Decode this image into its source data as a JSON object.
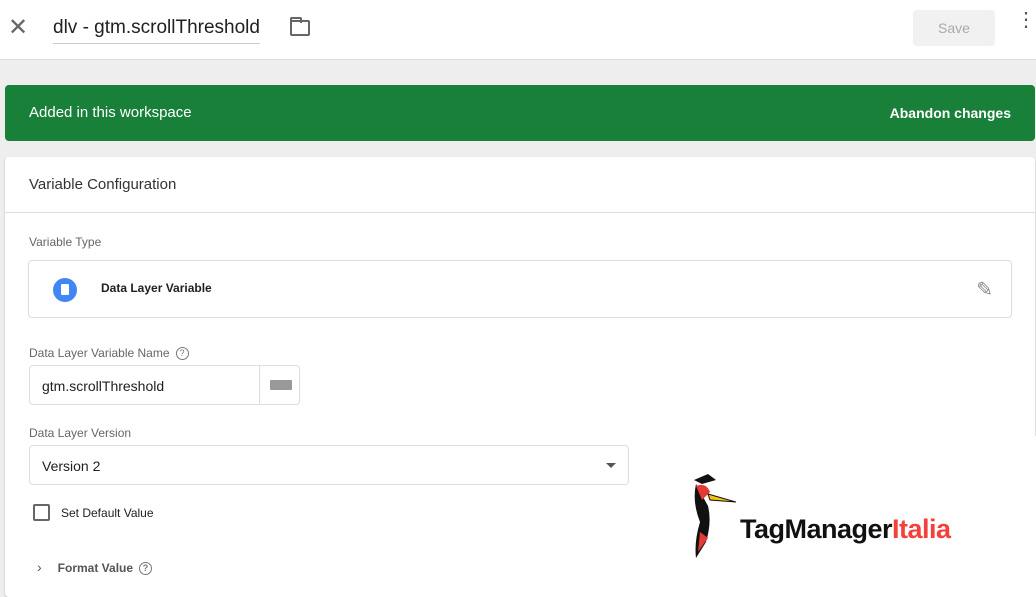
{
  "header": {
    "title": "dlv - gtm.scrollThreshold",
    "save_label": "Save"
  },
  "banner": {
    "message": "Added in this workspace",
    "action": "Abandon changes",
    "color": "#188038"
  },
  "card": {
    "title": "Variable Configuration",
    "variable_type_label": "Variable Type",
    "variable_type": "Data Layer Variable",
    "name_label": "Data Layer Variable Name",
    "name_value": "gtm.scrollThreshold",
    "version_label": "Data Layer Version",
    "version_value": "Version 2",
    "default_label": "Set Default Value",
    "default_checked": false,
    "format_label": "Format Value"
  },
  "logo": {
    "text_dark": "TagManager",
    "text_red": "Italia"
  }
}
